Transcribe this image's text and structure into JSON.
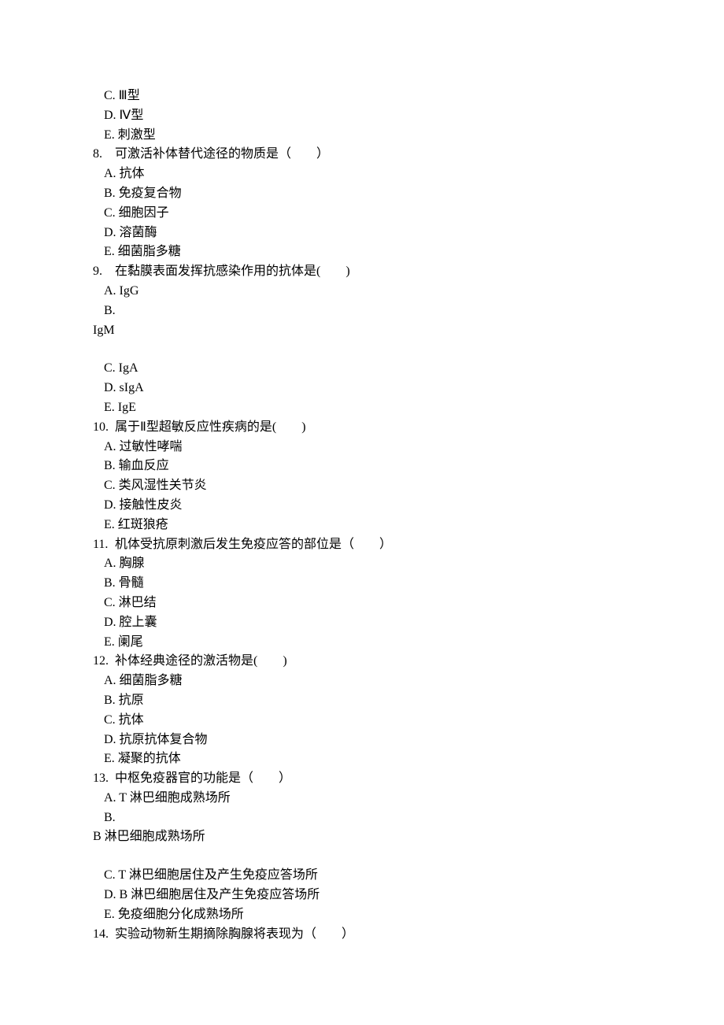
{
  "frag7": {
    "c": "C. Ⅲ型",
    "d": "D. Ⅳ型",
    "e": "E. 刺激型"
  },
  "q8": {
    "num": "8.",
    "stem": "可激活补体替代途径的物质是（　　）",
    "a": "A. 抗体",
    "b": "B. 免疫复合物",
    "c": "C. 细胞因子",
    "d": "D. 溶菌酶",
    "e": "E. 细菌脂多糖"
  },
  "q9": {
    "num": "9.",
    "stem": "在黏膜表面发挥抗感染作用的抗体是(　　)",
    "a": "A. IgG",
    "b_marker": "B.",
    "b_cont": "IgM",
    "c": "C. IgA",
    "d": "D. sIgA",
    "e": "E. IgE"
  },
  "q10": {
    "num": "10.",
    "stem": "属于Ⅱ型超敏反应性疾病的是(　　)",
    "a": "A. 过敏性哮喘",
    "b": "B. 输血反应",
    "c": "C. 类风湿性关节炎",
    "d": "D. 接触性皮炎",
    "e": "E. 红斑狼疮"
  },
  "q11": {
    "num": "11.",
    "stem": "机体受抗原刺激后发生免疫应答的部位是（　　）",
    "a": "A. 胸腺",
    "b": "B. 骨髓",
    "c": "C. 淋巴结",
    "d": "D. 腔上囊",
    "e": "E. 阑尾"
  },
  "q12": {
    "num": "12.",
    "stem": "补体经典途径的激活物是(　　)",
    "a": "A. 细菌脂多糖",
    "b": "B. 抗原",
    "c": "C. 抗体",
    "d": "D. 抗原抗体复合物",
    "e": "E. 凝聚的抗体"
  },
  "q13": {
    "num": "13.",
    "stem": "中枢免疫器官的功能是（　　）",
    "a": "A. T 淋巴细胞成熟场所",
    "b_marker": "B.",
    "b_cont": "B 淋巴细胞成熟场所",
    "c": "C. T 淋巴细胞居住及产生免疫应答场所",
    "d": "D. B 淋巴细胞居住及产生免疫应答场所",
    "e": "E. 免疫细胞分化成熟场所"
  },
  "q14": {
    "num": "14.",
    "stem": "实验动物新生期摘除胸腺将表现为（　　）"
  }
}
